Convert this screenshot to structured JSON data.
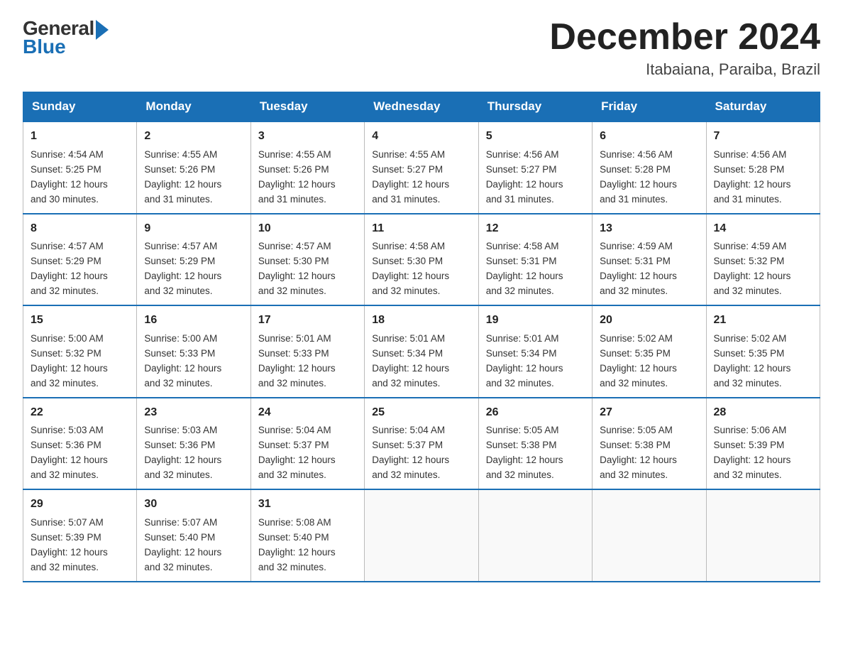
{
  "header": {
    "logo_general": "General",
    "logo_blue": "Blue",
    "title": "December 2024",
    "location": "Itabaiana, Paraiba, Brazil"
  },
  "days_of_week": [
    "Sunday",
    "Monday",
    "Tuesday",
    "Wednesday",
    "Thursday",
    "Friday",
    "Saturday"
  ],
  "weeks": [
    [
      {
        "day": "1",
        "sunrise": "4:54 AM",
        "sunset": "5:25 PM",
        "daylight": "12 hours and 30 minutes."
      },
      {
        "day": "2",
        "sunrise": "4:55 AM",
        "sunset": "5:26 PM",
        "daylight": "12 hours and 31 minutes."
      },
      {
        "day": "3",
        "sunrise": "4:55 AM",
        "sunset": "5:26 PM",
        "daylight": "12 hours and 31 minutes."
      },
      {
        "day": "4",
        "sunrise": "4:55 AM",
        "sunset": "5:27 PM",
        "daylight": "12 hours and 31 minutes."
      },
      {
        "day": "5",
        "sunrise": "4:56 AM",
        "sunset": "5:27 PM",
        "daylight": "12 hours and 31 minutes."
      },
      {
        "day": "6",
        "sunrise": "4:56 AM",
        "sunset": "5:28 PM",
        "daylight": "12 hours and 31 minutes."
      },
      {
        "day": "7",
        "sunrise": "4:56 AM",
        "sunset": "5:28 PM",
        "daylight": "12 hours and 31 minutes."
      }
    ],
    [
      {
        "day": "8",
        "sunrise": "4:57 AM",
        "sunset": "5:29 PM",
        "daylight": "12 hours and 32 minutes."
      },
      {
        "day": "9",
        "sunrise": "4:57 AM",
        "sunset": "5:29 PM",
        "daylight": "12 hours and 32 minutes."
      },
      {
        "day": "10",
        "sunrise": "4:57 AM",
        "sunset": "5:30 PM",
        "daylight": "12 hours and 32 minutes."
      },
      {
        "day": "11",
        "sunrise": "4:58 AM",
        "sunset": "5:30 PM",
        "daylight": "12 hours and 32 minutes."
      },
      {
        "day": "12",
        "sunrise": "4:58 AM",
        "sunset": "5:31 PM",
        "daylight": "12 hours and 32 minutes."
      },
      {
        "day": "13",
        "sunrise": "4:59 AM",
        "sunset": "5:31 PM",
        "daylight": "12 hours and 32 minutes."
      },
      {
        "day": "14",
        "sunrise": "4:59 AM",
        "sunset": "5:32 PM",
        "daylight": "12 hours and 32 minutes."
      }
    ],
    [
      {
        "day": "15",
        "sunrise": "5:00 AM",
        "sunset": "5:32 PM",
        "daylight": "12 hours and 32 minutes."
      },
      {
        "day": "16",
        "sunrise": "5:00 AM",
        "sunset": "5:33 PM",
        "daylight": "12 hours and 32 minutes."
      },
      {
        "day": "17",
        "sunrise": "5:01 AM",
        "sunset": "5:33 PM",
        "daylight": "12 hours and 32 minutes."
      },
      {
        "day": "18",
        "sunrise": "5:01 AM",
        "sunset": "5:34 PM",
        "daylight": "12 hours and 32 minutes."
      },
      {
        "day": "19",
        "sunrise": "5:01 AM",
        "sunset": "5:34 PM",
        "daylight": "12 hours and 32 minutes."
      },
      {
        "day": "20",
        "sunrise": "5:02 AM",
        "sunset": "5:35 PM",
        "daylight": "12 hours and 32 minutes."
      },
      {
        "day": "21",
        "sunrise": "5:02 AM",
        "sunset": "5:35 PM",
        "daylight": "12 hours and 32 minutes."
      }
    ],
    [
      {
        "day": "22",
        "sunrise": "5:03 AM",
        "sunset": "5:36 PM",
        "daylight": "12 hours and 32 minutes."
      },
      {
        "day": "23",
        "sunrise": "5:03 AM",
        "sunset": "5:36 PM",
        "daylight": "12 hours and 32 minutes."
      },
      {
        "day": "24",
        "sunrise": "5:04 AM",
        "sunset": "5:37 PM",
        "daylight": "12 hours and 32 minutes."
      },
      {
        "day": "25",
        "sunrise": "5:04 AM",
        "sunset": "5:37 PM",
        "daylight": "12 hours and 32 minutes."
      },
      {
        "day": "26",
        "sunrise": "5:05 AM",
        "sunset": "5:38 PM",
        "daylight": "12 hours and 32 minutes."
      },
      {
        "day": "27",
        "sunrise": "5:05 AM",
        "sunset": "5:38 PM",
        "daylight": "12 hours and 32 minutes."
      },
      {
        "day": "28",
        "sunrise": "5:06 AM",
        "sunset": "5:39 PM",
        "daylight": "12 hours and 32 minutes."
      }
    ],
    [
      {
        "day": "29",
        "sunrise": "5:07 AM",
        "sunset": "5:39 PM",
        "daylight": "12 hours and 32 minutes."
      },
      {
        "day": "30",
        "sunrise": "5:07 AM",
        "sunset": "5:40 PM",
        "daylight": "12 hours and 32 minutes."
      },
      {
        "day": "31",
        "sunrise": "5:08 AM",
        "sunset": "5:40 PM",
        "daylight": "12 hours and 32 minutes."
      },
      null,
      null,
      null,
      null
    ]
  ],
  "labels": {
    "sunrise": "Sunrise:",
    "sunset": "Sunset:",
    "daylight": "Daylight:"
  }
}
